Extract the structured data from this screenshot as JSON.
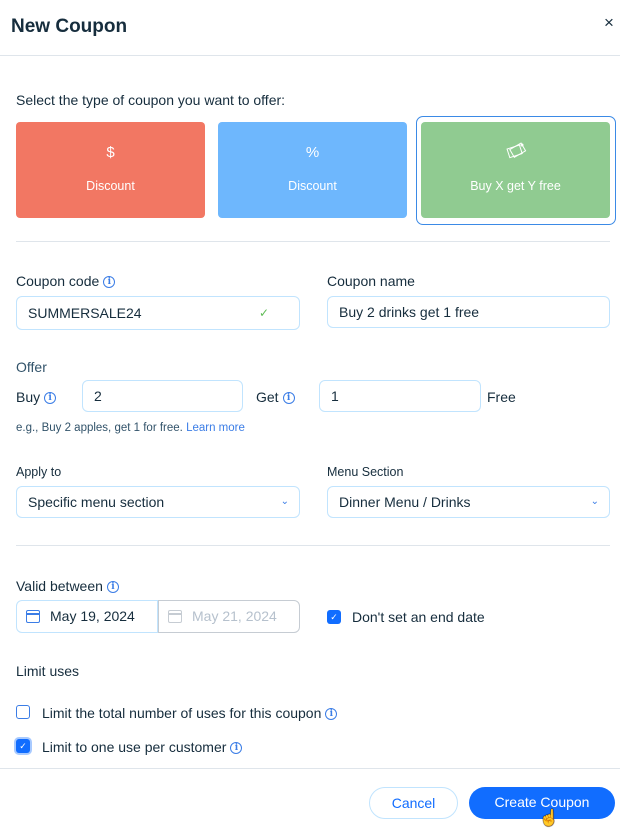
{
  "dialog": {
    "title": "New Coupon",
    "close_icon": "×"
  },
  "type_select": {
    "prompt": "Select the type of coupon you want to offer:",
    "options": [
      {
        "icon": "$",
        "label": "Discount",
        "color": "#f27763",
        "selected": false
      },
      {
        "icon": "%",
        "label": "Discount",
        "color": "#6eb7fd",
        "selected": false
      },
      {
        "icon": "tag-icon",
        "label": "Buy X get Y free",
        "color": "#90cb91",
        "selected": true
      }
    ]
  },
  "coupon_code": {
    "label": "Coupon code",
    "value": "SUMMERSALE24",
    "valid_mark": "✓"
  },
  "coupon_name": {
    "label": "Coupon name",
    "value": "Buy 2 drinks get 1 free"
  },
  "offer": {
    "label": "Offer",
    "buy_label": "Buy",
    "buy_value": "2",
    "get_label": "Get",
    "get_value": "1",
    "free_label": "Free",
    "hint": "e.g., Buy 2 apples, get 1 for free.",
    "learn_more": "Learn more"
  },
  "apply_to": {
    "label": "Apply to",
    "value": "Specific menu section"
  },
  "menu_section": {
    "label": "Menu Section",
    "value": "Dinner Menu / Drinks"
  },
  "validity": {
    "label": "Valid between",
    "start_date": "May 19, 2024",
    "end_date": "May 21, 2024",
    "no_end_label": "Don't set an end date",
    "no_end_checked": true
  },
  "limits": {
    "label": "Limit uses",
    "total_label": "Limit the total number of uses for this coupon",
    "total_checked": false,
    "per_customer_label": "Limit to one use per customer",
    "per_customer_checked": true
  },
  "footer": {
    "cancel_label": "Cancel",
    "create_label": "Create Coupon"
  },
  "info_glyph": "i",
  "check_glyph": "✓",
  "chevron_glyph": "⌄",
  "cursor_glyph": "☝"
}
